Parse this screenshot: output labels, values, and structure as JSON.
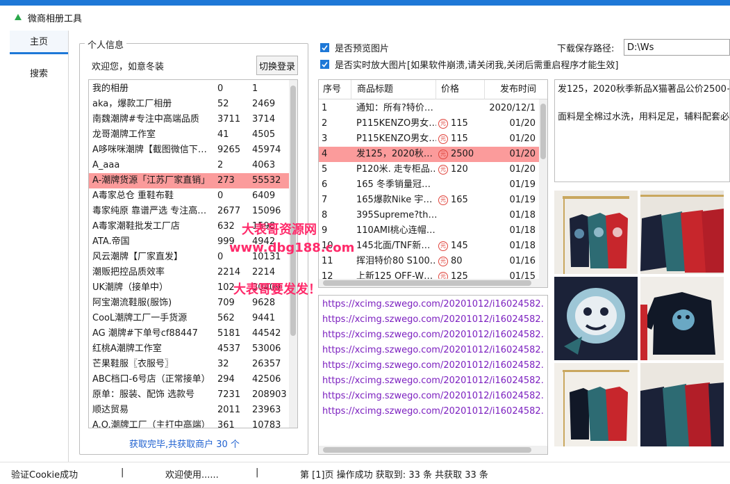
{
  "app": {
    "title": "微商相册工具"
  },
  "nav": {
    "home": "主页",
    "search": "搜索"
  },
  "profile": {
    "legend": "个人信息",
    "welcome": "欢迎您，如意冬装",
    "switch_label": "切换登录",
    "status": "获取完毕,共获取商户 30 个"
  },
  "albums": [
    {
      "name": "我的相册",
      "a": "0",
      "b": "1"
    },
    {
      "name": "aka，爆款工厂相册",
      "a": "52",
      "b": "2469"
    },
    {
      "name": "南魏潮牌#专注中高端品质",
      "a": "3711",
      "b": "3714"
    },
    {
      "name": "龙哥潮牌工作室",
      "a": "41",
      "b": "4505"
    },
    {
      "name": "A哆咪咪潮牌【截图微信下…",
      "a": "9265",
      "b": "45974"
    },
    {
      "name": "A_aaa",
      "a": "2",
      "b": "4063"
    },
    {
      "name": "A-潮牌货源「江苏厂家直销」",
      "a": "273",
      "b": "55532",
      "selected": true
    },
    {
      "name": "A毒家总仓 重鞋布鞋",
      "a": "0",
      "b": "6409"
    },
    {
      "name": "毒家纯原 靠谱严选 专注高…",
      "a": "2677",
      "b": "15096"
    },
    {
      "name": "A毒家潮鞋批发工厂店",
      "a": "632",
      "b": "1598"
    },
    {
      "name": "ATA.帝国",
      "a": "999",
      "b": "4942"
    },
    {
      "name": "风云潮牌【厂家直发】",
      "a": "0",
      "b": "10131"
    },
    {
      "name": "潮贩把控品质效率",
      "a": "2214",
      "b": "2214"
    },
    {
      "name": "UK潮牌（接单中）",
      "a": "102",
      "b": "30409"
    },
    {
      "name": "阿宝潮流鞋服(服饰)",
      "a": "709",
      "b": "9628"
    },
    {
      "name": "CooL潮牌工厂一手货源",
      "a": "562",
      "b": "9441"
    },
    {
      "name": "AG 潮牌#下单号cf88447",
      "a": "5181",
      "b": "44542"
    },
    {
      "name": "红桃A潮牌工作室",
      "a": "4537",
      "b": "53006"
    },
    {
      "name": "芒果鞋服〖衣服号〗",
      "a": "32",
      "b": "26357"
    },
    {
      "name": "ABC档口-6号店（正常接单）",
      "a": "294",
      "b": "42506"
    },
    {
      "name": "原单：服装、配饰 选款号",
      "a": "7231",
      "b": "208903"
    },
    {
      "name": "顺达贸易",
      "a": "2011",
      "b": "23963"
    },
    {
      "name": "A.O.潮牌工厂（主打中高端）",
      "a": "361",
      "b": "10783"
    }
  ],
  "options": {
    "preview_label": "是否预览图片",
    "realtime_label": "是否实时放大图片[如果软件崩溃,请关闭我,关闭后需重启程序才能生效]"
  },
  "download": {
    "label": "下载保存路径:",
    "path": "D:\\Ws"
  },
  "goods": {
    "headers": {
      "no": "序号",
      "title": "商品标题",
      "price": "价格",
      "date": "发布时间"
    },
    "yuan_icon": "元",
    "rows": [
      {
        "no": "1",
        "title": "通知：所有?特价…",
        "price": "",
        "date": "2020/12/1"
      },
      {
        "no": "2",
        "title": "P115KENZO男女…",
        "price": "115",
        "date": "01/20"
      },
      {
        "no": "3",
        "title": "P115KENZO男女…",
        "price": "115",
        "date": "01/20"
      },
      {
        "no": "4",
        "title": "发125，2020秋…",
        "price": "2500",
        "date": "01/20",
        "selected": true
      },
      {
        "no": "5",
        "title": "P120米. 走专柜品…",
        "price": "120",
        "date": "01/20"
      },
      {
        "no": "6",
        "title": "165 冬季销量冠…",
        "price": "",
        "date": "01/19"
      },
      {
        "no": "7",
        "title": "165爆款Nike 宇…",
        "price": "165",
        "date": "01/19"
      },
      {
        "no": "8",
        "title": "395Supreme?th…",
        "price": "",
        "date": "01/18"
      },
      {
        "no": "9",
        "title": "110AMI桃心连帽…",
        "price": "",
        "date": "01/18"
      },
      {
        "no": "10",
        "title": "145北面/TNF新…",
        "price": "145",
        "date": "01/18"
      },
      {
        "no": "11",
        "title": "挥泪特价80 S100…",
        "price": "80",
        "date": "01/16"
      },
      {
        "no": "12",
        "title": "上新125 OFF-W…",
        "price": "125",
        "date": "01/15"
      }
    ]
  },
  "description": {
    "line1": "发125，2020秋季新品X猫著品公价2500+",
    "line2": "面料是全棉过水洗，用料足足，辅料配套必"
  },
  "urls": [
    "https://xcimg.szwego.com/20201012/i16024582…",
    "https://xcimg.szwego.com/20201012/i16024582…",
    "https://xcimg.szwego.com/20201012/i16024582…",
    "https://xcimg.szwego.com/20201012/i16024582…",
    "https://xcimg.szwego.com/20201012/i16024582…",
    "https://xcimg.szwego.com/20201012/i16024582…",
    "https://xcimg.szwego.com/20201012/i16024582…",
    "https://xcimg.szwego.com/20201012/i16024582…"
  ],
  "watermark": {
    "line1": "大表哥资源网",
    "line2": "www.dbg188.com",
    "line3": "大表哥要发发！"
  },
  "statusbar": {
    "cookie": "验证Cookie成功",
    "sep1": "|",
    "welcome": "欢迎使用......",
    "sep2": "|",
    "result": "第 [1]页 操作成功   获取到:  33 条 共获取 33 条"
  },
  "colors": {
    "accent": "#1e78d7",
    "selection": "#fb9b9b",
    "link": "#7b1fbf",
    "price_icon": "#e0443c",
    "watermark": "#ff2a6a"
  }
}
